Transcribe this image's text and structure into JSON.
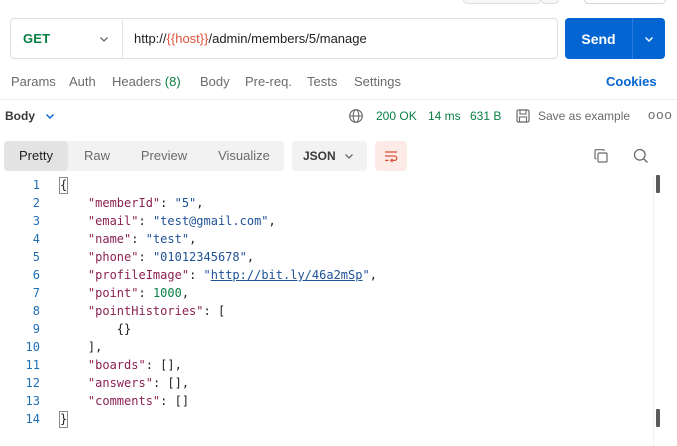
{
  "request": {
    "method": "GET",
    "url_prefix": "http://",
    "url_variable": "{{host}}",
    "url_suffix": "/admin/members/5/manage",
    "send_label": "Send"
  },
  "request_tabs": [
    {
      "label": "Params"
    },
    {
      "label": "Auth"
    },
    {
      "label": "Headers",
      "count": "(8)"
    },
    {
      "label": "Body"
    },
    {
      "label": "Pre-req."
    },
    {
      "label": "Tests"
    },
    {
      "label": "Settings"
    }
  ],
  "cookies_label": "Cookies",
  "response": {
    "body_label": "Body",
    "status": "200 OK",
    "time": "14 ms",
    "size": "631 B",
    "save_label": "Save as example",
    "more_label": "ooo"
  },
  "view_tabs": [
    {
      "label": "Pretty",
      "active": true
    },
    {
      "label": "Raw",
      "active": false
    },
    {
      "label": "Preview",
      "active": false
    },
    {
      "label": "Visualize",
      "active": false
    }
  ],
  "format_select": "JSON",
  "code_lines": [
    {
      "n": "1",
      "tokens": [
        [
          "p",
          "{"
        ]
      ]
    },
    {
      "n": "2",
      "tokens": [
        [
          "p",
          "    "
        ],
        [
          "k",
          "\"memberId\""
        ],
        [
          "p",
          ": "
        ],
        [
          "s",
          "\"5\""
        ],
        [
          "p",
          ","
        ]
      ]
    },
    {
      "n": "3",
      "tokens": [
        [
          "p",
          "    "
        ],
        [
          "k",
          "\"email\""
        ],
        [
          "p",
          ": "
        ],
        [
          "s",
          "\"test@gmail.com\""
        ],
        [
          "p",
          ","
        ]
      ]
    },
    {
      "n": "4",
      "tokens": [
        [
          "p",
          "    "
        ],
        [
          "k",
          "\"name\""
        ],
        [
          "p",
          ": "
        ],
        [
          "s",
          "\"test\""
        ],
        [
          "p",
          ","
        ]
      ]
    },
    {
      "n": "5",
      "tokens": [
        [
          "p",
          "    "
        ],
        [
          "k",
          "\"phone\""
        ],
        [
          "p",
          ": "
        ],
        [
          "s",
          "\"01012345678\""
        ],
        [
          "p",
          ","
        ]
      ]
    },
    {
      "n": "6",
      "tokens": [
        [
          "p",
          "    "
        ],
        [
          "k",
          "\"profileImage\""
        ],
        [
          "p",
          ": "
        ],
        [
          "s",
          "\""
        ],
        [
          "link",
          "http://bit.ly/46a2mSp"
        ],
        [
          "s",
          "\""
        ],
        [
          "p",
          ","
        ]
      ]
    },
    {
      "n": "7",
      "tokens": [
        [
          "p",
          "    "
        ],
        [
          "k",
          "\"point\""
        ],
        [
          "p",
          ": "
        ],
        [
          "n",
          "1000"
        ],
        [
          "p",
          ","
        ]
      ]
    },
    {
      "n": "8",
      "tokens": [
        [
          "p",
          "    "
        ],
        [
          "k",
          "\"pointHistories\""
        ],
        [
          "p",
          ": ["
        ]
      ]
    },
    {
      "n": "9",
      "tokens": [
        [
          "p",
          "        {}"
        ]
      ]
    },
    {
      "n": "10",
      "tokens": [
        [
          "p",
          "    ],"
        ]
      ]
    },
    {
      "n": "11",
      "tokens": [
        [
          "p",
          "    "
        ],
        [
          "k",
          "\"boards\""
        ],
        [
          "p",
          ": [],"
        ]
      ]
    },
    {
      "n": "12",
      "tokens": [
        [
          "p",
          "    "
        ],
        [
          "k",
          "\"answers\""
        ],
        [
          "p",
          ": [],"
        ]
      ]
    },
    {
      "n": "13",
      "tokens": [
        [
          "p",
          "    "
        ],
        [
          "k",
          "\"comments\""
        ],
        [
          "p",
          ": []"
        ]
      ]
    },
    {
      "n": "14",
      "tokens": [
        [
          "p",
          "}"
        ]
      ]
    }
  ],
  "colors": {
    "accent": "#0265d2",
    "method_get": "#0a7f43",
    "variable": "#e0533f",
    "status_ok": "#0a7f43"
  }
}
